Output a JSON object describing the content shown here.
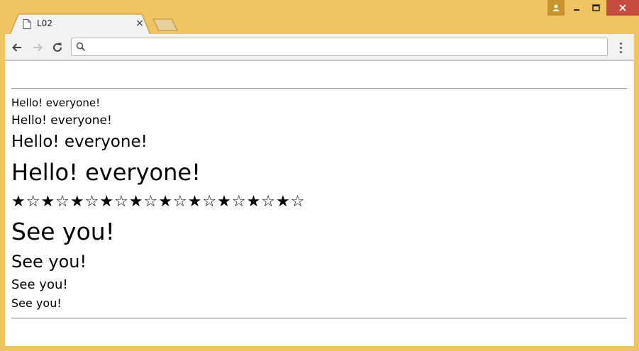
{
  "tab": {
    "title": "L02",
    "close_glyph": "×"
  },
  "toolbar": {
    "omnibox_value": "",
    "icons": [
      "back-arrow-icon",
      "forward-arrow-icon",
      "reload-icon",
      "search-icon",
      "menu-icon"
    ]
  },
  "window": {
    "accent": "#f0c461",
    "close_color": "#c74c40"
  },
  "page": {
    "hello_lines": [
      "Hello! everyone!",
      "Hello! everyone!",
      "Hello! everyone!",
      "Hello! everyone!"
    ],
    "stars": "★☆★☆★☆★☆★☆★☆★☆★☆★☆★☆",
    "seeyou_lines": [
      "See you!",
      "See you!",
      "See you!",
      "See you!"
    ]
  }
}
